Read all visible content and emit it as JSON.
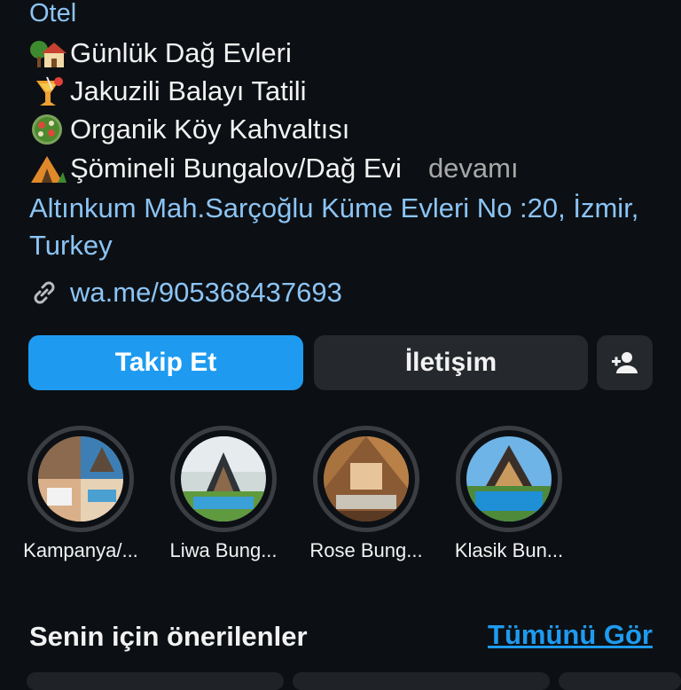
{
  "profile": {
    "category": "Otel",
    "bio": [
      {
        "icon": "house-with-tree-icon",
        "text": "Günlük Dağ Evleri"
      },
      {
        "icon": "tropical-drink-icon",
        "text": "Jakuzili Balayı Tatili"
      },
      {
        "icon": "salad-icon",
        "text": "Organik Köy Kahvaltısı"
      },
      {
        "icon": "camping-tent-icon",
        "text": "Şömineli Bungalov/Dağ Evi"
      }
    ],
    "more_label": "devamı",
    "address": "Altınkum Mah.Sarçoğlu Küme Evleri No :20, İzmir, Turkey",
    "link": "wa.me/905368437693"
  },
  "actions": {
    "follow_label": "Takip Et",
    "contact_label": "İletişim",
    "add_user_icon": "add-person-icon"
  },
  "highlights": [
    {
      "label": "Kampanya/..."
    },
    {
      "label": "Liwa Bung..."
    },
    {
      "label": "Rose Bung..."
    },
    {
      "label": "Klasik Bun..."
    }
  ],
  "suggestions": {
    "title": "Senin için önerilenler",
    "see_all_label": "Tümünü Gör"
  },
  "colors": {
    "background": "#0c1014",
    "accent": "#1e9bf0",
    "link": "#8cc4f5",
    "secondary_button": "#25282c"
  }
}
